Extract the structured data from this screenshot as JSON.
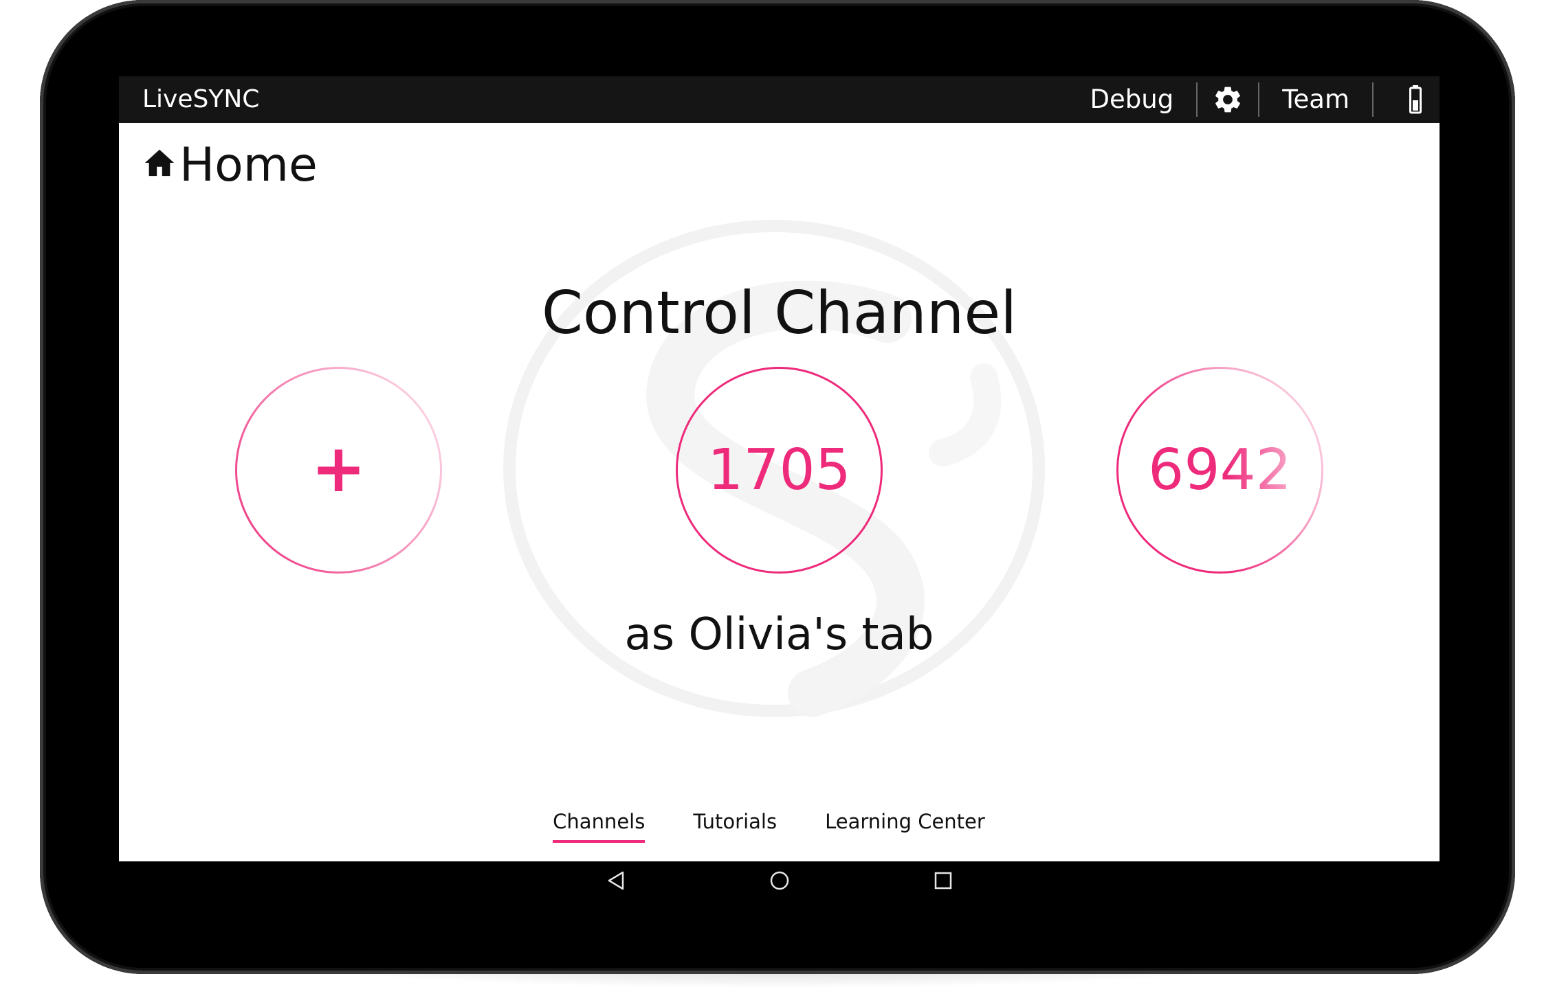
{
  "topbar": {
    "app_title": "LiveSYNC",
    "debug_label": "Debug",
    "team_label": "Team",
    "settings_icon": "gear-icon",
    "battery_icon": "battery-icon"
  },
  "header": {
    "icon": "home-icon",
    "title": "Home"
  },
  "main": {
    "heading": "Control Channel",
    "channels": [
      {
        "label": "+"
      },
      {
        "label": "1705"
      },
      {
        "label": "6942"
      }
    ],
    "subtitle": "as Olivia's tab"
  },
  "tabs": [
    {
      "label": "Channels",
      "active": true
    },
    {
      "label": "Tutorials",
      "active": false
    },
    {
      "label": "Learning Center",
      "active": false
    }
  ],
  "navbar": {
    "back_icon": "back-triangle-icon",
    "home_icon": "home-circle-icon",
    "recents_icon": "recents-square-icon"
  },
  "colors": {
    "accent": "#ee2a7b",
    "topbar_bg": "#151515",
    "device_bezel": "#000000"
  }
}
